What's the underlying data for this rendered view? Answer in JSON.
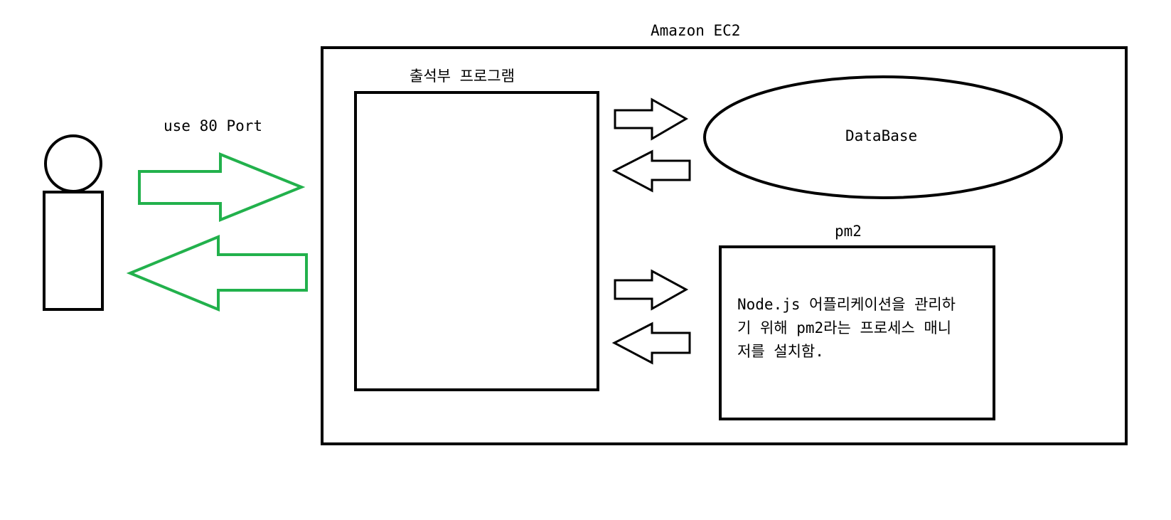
{
  "labels": {
    "ec2": "Amazon EC2",
    "program": "출석부 프로그램",
    "port": "use 80 Port",
    "database": "DataBase",
    "pm2": "pm2"
  },
  "pm2_description": "Node.js 어플리케이션을 관리하\n기 위해 pm2라는 프로세스 매니\n저를 설치함.",
  "colors": {
    "outline": "#000000",
    "client_arrows": "#22b14c",
    "background": "#ffffff"
  }
}
